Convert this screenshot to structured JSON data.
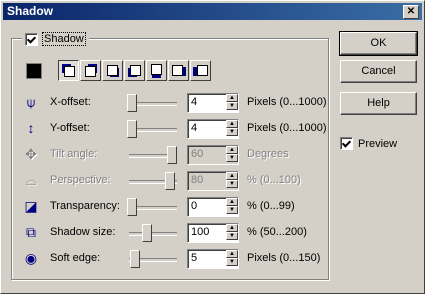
{
  "window": {
    "title": "Shadow",
    "close_glyph": "✕"
  },
  "group": {
    "label": "Shadow",
    "checked": true
  },
  "color_swatch": {
    "color": "#000000"
  },
  "directions": [
    {
      "name": "upper-left",
      "pressed": true
    },
    {
      "name": "upper-right",
      "pressed": false
    },
    {
      "name": "lower-right",
      "pressed": false
    },
    {
      "name": "lower-left",
      "pressed": false
    },
    {
      "name": "down",
      "pressed": false
    },
    {
      "name": "right-down",
      "pressed": false
    },
    {
      "name": "left-down",
      "pressed": false
    }
  ],
  "rows": [
    {
      "id": "x-offset",
      "icon": "x-offset-icon",
      "label": "X-offset:",
      "value": "4",
      "units": "Pixels (0...1000)",
      "enabled": true,
      "slider": 0.0
    },
    {
      "id": "y-offset",
      "icon": "y-offset-icon",
      "label": "Y-offset:",
      "value": "4",
      "units": "Pixels (0...1000)",
      "enabled": true,
      "slider": 0.0
    },
    {
      "id": "tilt-angle",
      "icon": "tilt-angle-icon",
      "label": "Tilt angle:",
      "value": "60",
      "units": "Degrees",
      "enabled": false,
      "slider": 0.85
    },
    {
      "id": "perspective",
      "icon": "perspective-icon",
      "label": "Perspective:",
      "value": "80",
      "units": "% (0...100)",
      "enabled": false,
      "slider": 0.8
    },
    {
      "id": "transparency",
      "icon": "transparency-icon",
      "label": "Transparency:",
      "value": "0",
      "units": "% (0...99)",
      "enabled": true,
      "slider": 0.0
    },
    {
      "id": "shadow-size",
      "icon": "shadow-size-icon",
      "label": "Shadow size:",
      "value": "100",
      "units": "% (50...200)",
      "enabled": true,
      "slider": 0.33
    },
    {
      "id": "soft-edge",
      "icon": "soft-edge-icon",
      "label": "Soft edge:",
      "value": "5",
      "units": "Pixels (0...150)",
      "enabled": true,
      "slider": 0.05
    }
  ],
  "buttons": {
    "ok": "OK",
    "cancel": "Cancel",
    "help": "Help"
  },
  "preview": {
    "label": "Preview",
    "checked": true
  }
}
